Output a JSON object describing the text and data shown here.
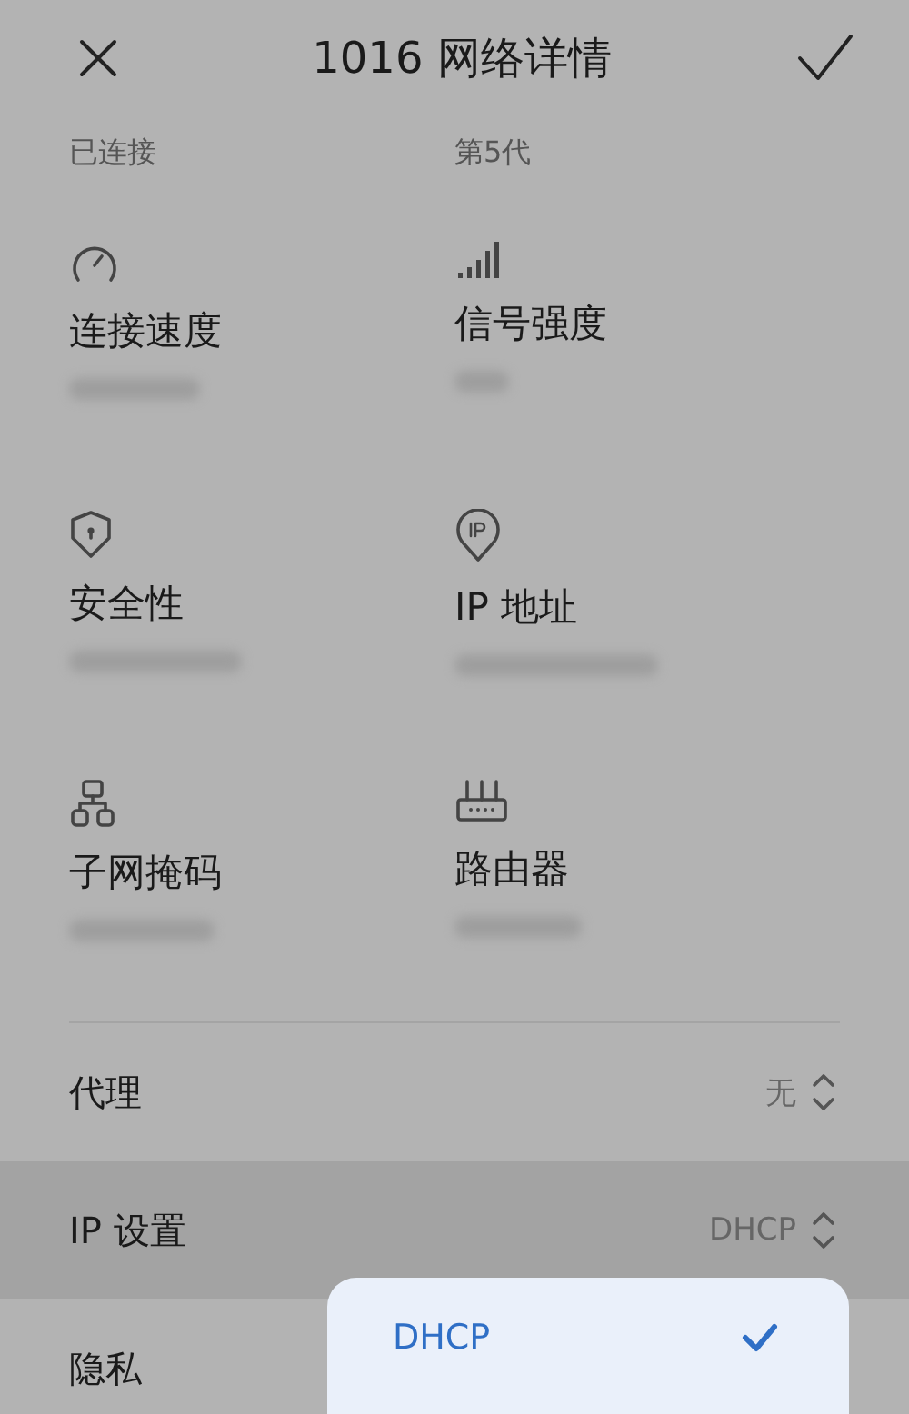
{
  "header": {
    "title": "1016 网络详情"
  },
  "status": [
    {
      "text": "已连接"
    },
    {
      "text": "第5代"
    }
  ],
  "details": [
    {
      "kind": "speed",
      "label": "连接速度"
    },
    {
      "kind": "signal",
      "label": "信号强度"
    },
    {
      "kind": "shield",
      "label": "安全性"
    },
    {
      "kind": "pin",
      "label": "IP 地址"
    },
    {
      "kind": "subnet",
      "label": "子网掩码"
    },
    {
      "kind": "router",
      "label": "路由器"
    }
  ],
  "settings": [
    {
      "label": "代理",
      "value": "无",
      "selected": false
    },
    {
      "label": "IP 设置",
      "value": "DHCP",
      "selected": true
    },
    {
      "label": "隐私",
      "selected": false
    }
  ],
  "popup": {
    "options": [
      {
        "label": "DHCP",
        "selected": true
      }
    ]
  }
}
